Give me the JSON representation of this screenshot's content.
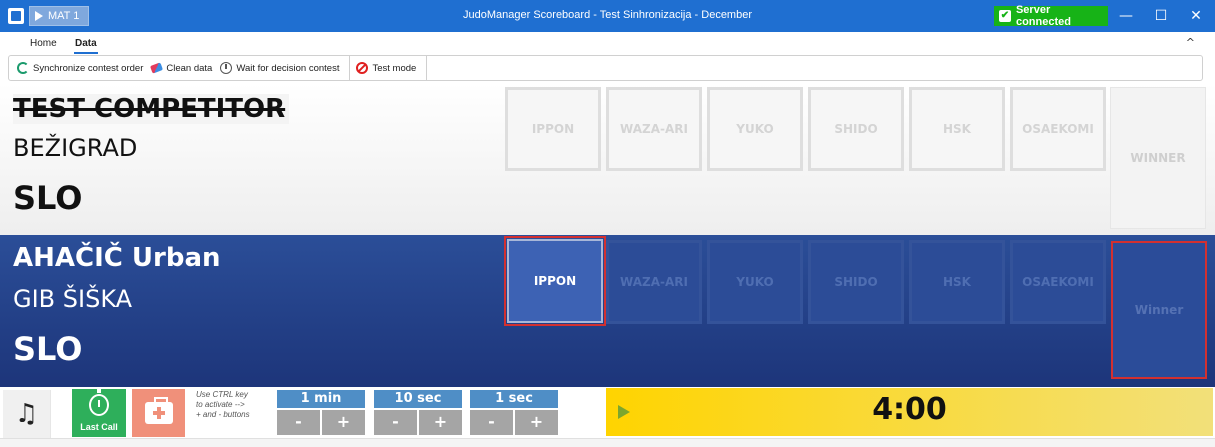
{
  "window": {
    "mat_label": "MAT 1",
    "title": "JudoManager Scoreboard - Test Sinhronizacija - December",
    "server_status": "Server connected",
    "controls": [
      "—",
      "☐",
      "✕"
    ]
  },
  "ribbon": {
    "tabs": [
      {
        "label": "Home",
        "active": false
      },
      {
        "label": "Data",
        "active": true
      }
    ],
    "collapse_glyph": "^",
    "toolbar": [
      {
        "label": "Synchronize contest order",
        "icon": "sync-icon"
      },
      {
        "label": "Clean data",
        "icon": "eraser-icon"
      },
      {
        "label": "Wait for decision contest",
        "icon": "stopwatch-icon"
      },
      {
        "label": "Test mode",
        "icon": "no-entry-icon"
      }
    ]
  },
  "white": {
    "name": "TEST COMPETITOR",
    "club": "BEŽIGRAD",
    "country": "SLO",
    "scores": [
      "IPPON",
      "WAZA-ARI",
      "YUKO",
      "SHIDO",
      "HSK",
      "OSAEKOMI"
    ],
    "winner_label": "WINNER"
  },
  "blue": {
    "name": "AHAČIČ Urban",
    "club": "GIB ŠIŠKA",
    "country": "SLO",
    "scores": [
      "IPPON",
      "WAZA-ARI",
      "YUKO",
      "SHIDO",
      "HSK",
      "OSAEKOMI"
    ],
    "active_score": "IPPON",
    "winner_label": "Winner"
  },
  "controls": {
    "music_glyph": "♫",
    "last_call": "Last Call",
    "hint": "Use CTRL key\nto activate     -->\n+ and - buttons",
    "adjusters": [
      {
        "title": "1 min",
        "minus": "-",
        "plus": "+"
      },
      {
        "title": "10 sec",
        "minus": "-",
        "plus": "+"
      },
      {
        "title": "1 sec",
        "minus": "-",
        "plus": "+"
      }
    ],
    "timer": "4:00"
  },
  "colors": {
    "title_bar": "#1f6fd1",
    "server_ok": "#17b317",
    "blue_panel": "#2b4e98",
    "highlight": "#d33030",
    "timer": "#ffd400"
  }
}
